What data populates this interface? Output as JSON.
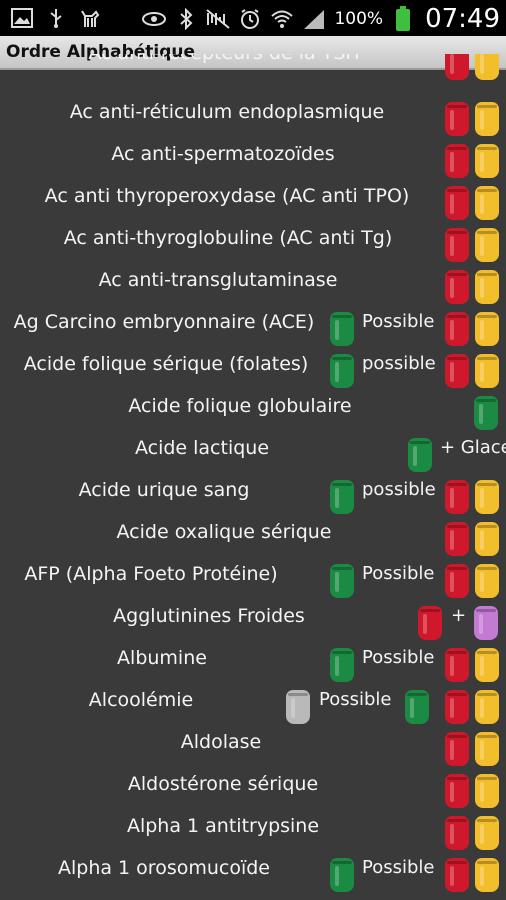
{
  "status_bar": {
    "battery": "100%",
    "clock": "07:49"
  },
  "title_bar": {
    "title": "Ordre Alphabétique"
  },
  "rows": [
    {
      "name": "Ac anti-récepteurs de la TSH",
      "note": ""
    },
    {
      "name": "Ac anti-réticulum endoplasmique",
      "note": ""
    },
    {
      "name": "Ac anti-spermatozoïdes",
      "note": ""
    },
    {
      "name": "Ac anti thyroperoxydase (AC anti TPO)",
      "note": ""
    },
    {
      "name": "Ac anti-thyroglobuline (AC anti Tg)",
      "note": ""
    },
    {
      "name": "Ac anti-transglutaminase",
      "note": ""
    },
    {
      "name": "Ag Carcino embryonnaire (ACE)",
      "note": "Possible"
    },
    {
      "name": "Acide folique sérique (folates)",
      "note": "possible"
    },
    {
      "name": "Acide folique globulaire",
      "note": ""
    },
    {
      "name": "Acide lactique",
      "note": "+ Glace"
    },
    {
      "name": "Acide urique sang",
      "note": "possible"
    },
    {
      "name": "Acide oxalique sérique",
      "note": ""
    },
    {
      "name": "AFP (Alpha Foeto Protéine)",
      "note": "Possible"
    },
    {
      "name": "Agglutinines Froides",
      "note": "+"
    },
    {
      "name": "Albumine",
      "note": "Possible"
    },
    {
      "name": "Alcoolémie",
      "note": "Possible"
    },
    {
      "name": "Aldolase",
      "note": ""
    },
    {
      "name": "Aldostérone sérique",
      "note": ""
    },
    {
      "name": "Alpha 1 antitrypsine",
      "note": ""
    },
    {
      "name": "Alpha 1 orosomucoïde",
      "note": "Possible"
    }
  ]
}
